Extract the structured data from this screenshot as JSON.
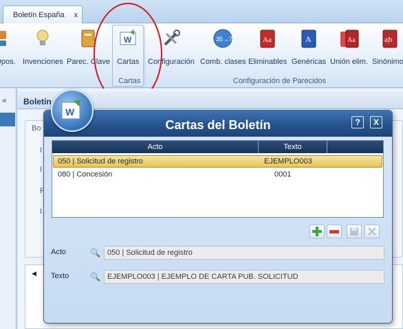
{
  "tab": {
    "label": "Boletín España",
    "close": "x"
  },
  "ribbon": {
    "items": [
      {
        "label": "Opos.",
        "icon": "oppositions-icon",
        "color": "#d6862a"
      },
      {
        "label": "Invenciones",
        "icon": "lightbulb-icon",
        "color": "#e8c44a"
      },
      {
        "label": "Parec. Clave",
        "icon": "book-key-icon",
        "color": "#e0a23a"
      },
      {
        "label": "Cartas",
        "icon": "word-letter-icon",
        "color": "#2b62b0"
      },
      {
        "label": "Configuración",
        "icon": "tools-icon",
        "color": "#596a7d"
      },
      {
        "label": "Comb. clases",
        "icon": "class-combine-icon",
        "color": "#2e70c2"
      },
      {
        "label": "Eliminables",
        "icon": "dictionary-red-icon",
        "color": "#c52a2a"
      },
      {
        "label": "Genéricas",
        "icon": "dictionary-blue-icon",
        "color": "#2a5ab8"
      },
      {
        "label": "Unión elim.",
        "icon": "dictionary-union-icon",
        "color": "#b42424"
      },
      {
        "label": "Sinónimos",
        "icon": "dictionary-synonyms-icon",
        "color": "#b82828"
      }
    ],
    "groups": {
      "cartas": "Cartas",
      "config": "Configuración de Parecidos"
    }
  },
  "background": {
    "collapse": "«",
    "main_title": "Boletín",
    "form_label": "Bo",
    "letters": [
      "I",
      "I",
      "F",
      "I"
    ],
    "arrow": "◀"
  },
  "dialog": {
    "title": "Cartas del Boletín",
    "help": "?",
    "close": "X",
    "columns": [
      "Acto",
      "Texto"
    ],
    "rows": [
      {
        "acto": "050 | Solicitud de registro",
        "texto": "EJEMPLO003",
        "selected": true
      },
      {
        "acto": "080 | Concesión",
        "texto": "0001",
        "selected": false
      }
    ],
    "fields": {
      "acto_label": "Acto",
      "acto_value": "050 | Solicitud de registro",
      "texto_label": "Texto",
      "texto_value": "EJEMPLO003 | EJEMPLO DE CARTA PUB. SOLICITUD"
    },
    "colors": {
      "title_bg": "#26548f",
      "selected_row": "#e9c55a",
      "grid_header": "#163456"
    }
  }
}
